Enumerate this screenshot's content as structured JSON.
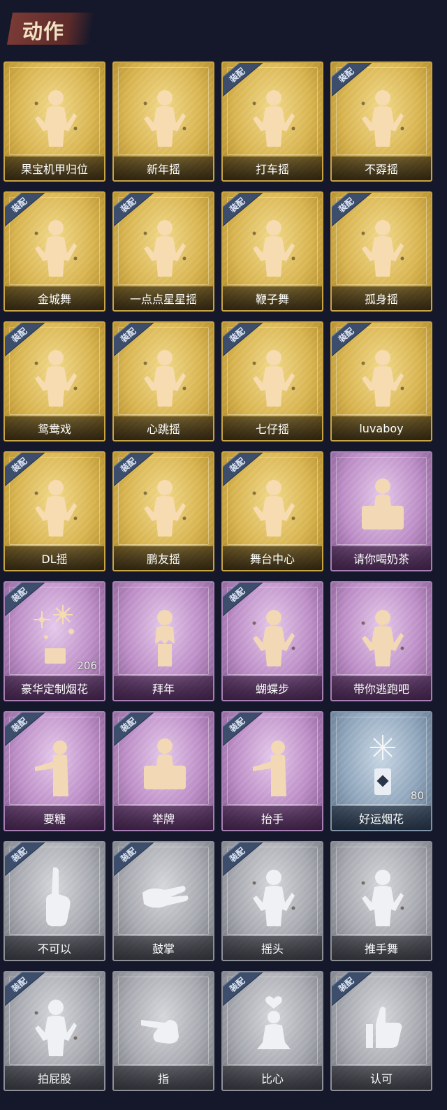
{
  "section": {
    "title": "动作"
  },
  "equip_tag_label": "装配",
  "colors": {
    "gold": "#d8b44f",
    "purple": "#bc8dc6",
    "blue": "#8fa5bb",
    "grey": "#a7a9b0",
    "equip_tag": "#3c4e6c"
  },
  "cards": [
    {
      "label": "果宝机甲归位",
      "tier": "gold",
      "equipped": false,
      "icon": "dance-pose-icon"
    },
    {
      "label": "新年摇",
      "tier": "gold",
      "equipped": false,
      "icon": "dance-pose-icon"
    },
    {
      "label": "打车摇",
      "tier": "gold",
      "equipped": true,
      "icon": "dance-pose-icon"
    },
    {
      "label": "不孬摇",
      "tier": "gold",
      "equipped": true,
      "icon": "dance-pose-icon"
    },
    {
      "label": "金城舞",
      "tier": "gold",
      "equipped": true,
      "icon": "dance-pose-icon"
    },
    {
      "label": "一点点星星摇",
      "tier": "gold",
      "equipped": true,
      "icon": "dance-pose-icon"
    },
    {
      "label": "鞭子舞",
      "tier": "gold",
      "equipped": true,
      "icon": "dance-pose-icon"
    },
    {
      "label": "孤身摇",
      "tier": "gold",
      "equipped": true,
      "icon": "dance-pose-icon"
    },
    {
      "label": "鸳鸯戏",
      "tier": "gold",
      "equipped": true,
      "icon": "dance-pose-icon"
    },
    {
      "label": "心跳摇",
      "tier": "gold",
      "equipped": true,
      "icon": "dance-pose-icon"
    },
    {
      "label": "七仔摇",
      "tier": "gold",
      "equipped": true,
      "icon": "dance-pose-icon"
    },
    {
      "label": "luvaboy",
      "tier": "gold",
      "equipped": true,
      "icon": "dance-pose-icon"
    },
    {
      "label": "DL摇",
      "tier": "gold",
      "equipped": true,
      "icon": "dance-pose-icon"
    },
    {
      "label": "鹏友摇",
      "tier": "gold",
      "equipped": true,
      "icon": "dance-pose-icon"
    },
    {
      "label": "舞台中心",
      "tier": "gold",
      "equipped": true,
      "icon": "dance-pose-icon"
    },
    {
      "label": "请你喝奶茶",
      "tier": "purple",
      "equipped": false,
      "icon": "holding-sign-icon"
    },
    {
      "label": "豪华定制烟花",
      "tier": "purple",
      "equipped": true,
      "icon": "fireworks-icon",
      "count": "206"
    },
    {
      "label": "拜年",
      "tier": "purple",
      "equipped": false,
      "icon": "bow-greeting-icon"
    },
    {
      "label": "蝴蝶步",
      "tier": "purple",
      "equipped": true,
      "icon": "dance-pose-icon"
    },
    {
      "label": "带你逃跑吧",
      "tier": "purple",
      "equipped": false,
      "icon": "dance-pose-icon"
    },
    {
      "label": "要糖",
      "tier": "purple",
      "equipped": true,
      "icon": "reach-hand-icon"
    },
    {
      "label": "举牌",
      "tier": "purple",
      "equipped": true,
      "icon": "holding-sign-icon"
    },
    {
      "label": "抬手",
      "tier": "purple",
      "equipped": true,
      "icon": "reach-hand-icon"
    },
    {
      "label": "好运烟花",
      "tier": "blue",
      "equipped": false,
      "icon": "firework-can-icon",
      "count": "80"
    },
    {
      "label": "不可以",
      "tier": "grey",
      "equipped": true,
      "icon": "finger-wag-icon"
    },
    {
      "label": "鼓掌",
      "tier": "grey",
      "equipped": true,
      "icon": "clapping-hands-icon"
    },
    {
      "label": "摇头",
      "tier": "grey",
      "equipped": true,
      "icon": "dance-pose-icon"
    },
    {
      "label": "推手舞",
      "tier": "grey",
      "equipped": false,
      "icon": "dance-pose-icon"
    },
    {
      "label": "拍屁股",
      "tier": "grey",
      "equipped": true,
      "icon": "dance-pose-icon"
    },
    {
      "label": "指",
      "tier": "grey",
      "equipped": false,
      "icon": "pointing-hand-icon"
    },
    {
      "label": "比心",
      "tier": "grey",
      "equipped": true,
      "icon": "finger-heart-icon"
    },
    {
      "label": "认可",
      "tier": "grey",
      "equipped": true,
      "icon": "thumbs-up-icon"
    }
  ]
}
